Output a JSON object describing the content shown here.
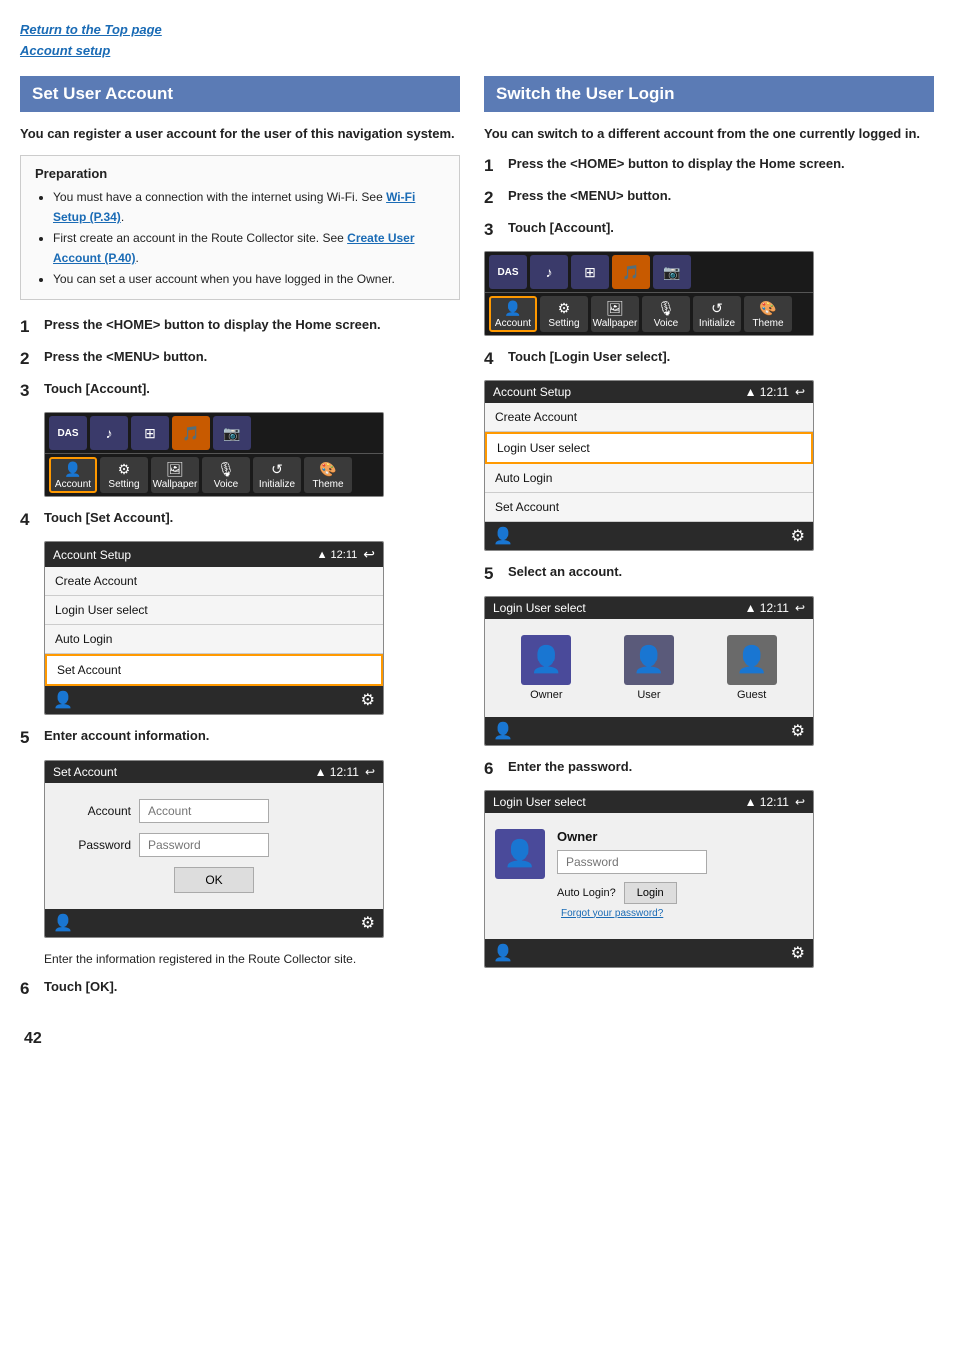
{
  "topLinks": {
    "link1": "Return to the Top page",
    "link2": "Account setup"
  },
  "left": {
    "header": "Set User Account",
    "intro": "You can register a user account for the user of this navigation system.",
    "prep": {
      "title": "Preparation",
      "items": [
        "You must have a connection with the internet using Wi-Fi. See Wi-Fi Setup (P.34).",
        "First create an account in the Route Collector site. See Create User Account (P.40).",
        "You can set a user account when you have logged in the Owner."
      ],
      "link1": "Wi-Fi Setup (P.34)",
      "link2": "Create User Account (P.40)"
    },
    "steps": [
      {
        "num": "1",
        "text": "Press the <HOME> button to display the Home screen."
      },
      {
        "num": "2",
        "text": "Press the <MENU> button."
      },
      {
        "num": "3",
        "text": "Touch [Account]."
      },
      {
        "num": "4",
        "text": "Touch [Set Account]."
      },
      {
        "num": "5",
        "text": "Enter account information."
      },
      {
        "num": "6",
        "text": "Touch [OK]."
      }
    ],
    "caption": "Enter the information registered in the Route Collector site.",
    "menuItems": [
      "Account Setup",
      "Create Account",
      "Login User select",
      "Auto Login",
      "Set Account"
    ],
    "setAccountFields": {
      "accountLabel": "Account",
      "accountPlaceholder": "Account",
      "passwordLabel": "Password",
      "passwordPlaceholder": "Password",
      "okButton": "OK"
    }
  },
  "right": {
    "header": "Switch the User Login",
    "intro": "You can switch to a different account from the one currently logged in.",
    "steps": [
      {
        "num": "1",
        "text": "Press the <HOME> button to display the Home screen."
      },
      {
        "num": "2",
        "text": "Press the <MENU> button."
      },
      {
        "num": "3",
        "text": "Touch [Account]."
      },
      {
        "num": "4",
        "text": "Touch [Login User select]."
      },
      {
        "num": "5",
        "text": "Select an account."
      },
      {
        "num": "6",
        "text": "Enter the password."
      }
    ],
    "menuItemsRight": [
      "Account Setup",
      "Create Account",
      "Login User select",
      "Auto Login",
      "Set Account"
    ],
    "users": [
      "Owner",
      "User",
      "Guest"
    ],
    "pwFields": {
      "name": "Owner",
      "placeholder": "Password",
      "autoLogin": "Auto Login?",
      "loginBtn": "Login",
      "forgot": "Forgot your password?"
    }
  },
  "pageNum": "42",
  "wifi": "12:11",
  "backArrow": "↩",
  "gearIcon": "⚙",
  "personIcon": "👤"
}
